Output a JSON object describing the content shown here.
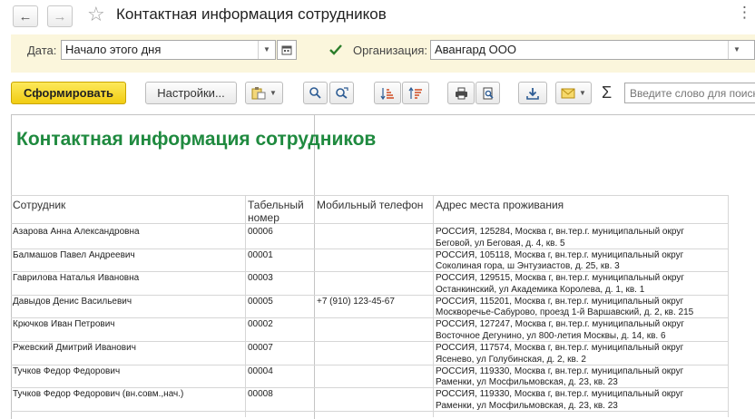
{
  "window": {
    "title": "Контактная информация сотрудников",
    "back_glyph": "←",
    "forward_glyph": "→",
    "favorite_glyph": "☆",
    "menu_glyph": "⋮"
  },
  "filters": {
    "date_label": "Дата:",
    "date_value": "Начало этого дня",
    "org_checked": true,
    "org_label": "Организация:",
    "org_value": "Авангард ООО"
  },
  "toolbar": {
    "generate_label": "Сформировать",
    "settings_label": "Настройки...",
    "sigma_glyph": "Σ",
    "search_placeholder": "Введите слово для поиска"
  },
  "report": {
    "title": "Контактная информация сотрудников",
    "columns": {
      "employee": "Сотрудник",
      "tab_no_1": "Табельный",
      "tab_no_2": "номер",
      "phone": "Мобильный телефон",
      "address": "Адрес места проживания"
    },
    "rows": [
      {
        "name": "Азарова Анна Александровна",
        "tab": "00006",
        "phone": "",
        "addr1": "РОССИЯ, 125284, Москва г, вн.тер.г. муниципальный округ",
        "addr2": "Беговой, ул Беговая, д. 4, кв. 5"
      },
      {
        "name": "Балмашов Павел Андреевич",
        "tab": "00001",
        "phone": "",
        "addr1": "РОССИЯ, 105118, Москва г, вн.тер.г. муниципальный округ",
        "addr2": "Соколиная гора, ш Энтузиастов, д. 25, кв. 3"
      },
      {
        "name": "Гаврилова Наталья Ивановна",
        "tab": "00003",
        "phone": "",
        "addr1": "РОССИЯ, 129515, Москва г, вн.тер.г. муниципальный округ",
        "addr2": "Останкинский, ул Академика Королева, д. 1, кв. 1"
      },
      {
        "name": "Давыдов Денис Васильевич",
        "tab": "00005",
        "phone": "+7 (910) 123-45-67",
        "addr1": "РОССИЯ, 115201, Москва г, вн.тер.г. муниципальный округ",
        "addr2": "Москворечье-Сабурово, проезд 1-й Варшавский, д. 2, кв. 215"
      },
      {
        "name": "Крючков Иван Петрович",
        "tab": "00002",
        "phone": "",
        "addr1": "РОССИЯ, 127247, Москва г, вн.тер.г. муниципальный округ",
        "addr2": "Восточное Дегунино, ул 800-летия Москвы, д. 14, кв. 6"
      },
      {
        "name": "Ржевский Дмитрий Иванович",
        "tab": "00007",
        "phone": "",
        "addr1": "РОССИЯ, 117574, Москва г, вн.тер.г. муниципальный округ",
        "addr2": "Ясенево, ул Голубинская, д. 2, кв. 2"
      },
      {
        "name": "Тучков Федор Федорович",
        "tab": "00004",
        "phone": "",
        "addr1": "РОССИЯ, 119330, Москва г, вн.тер.г. муниципальный округ",
        "addr2": "Раменки, ул Мосфильмовская, д. 23, кв. 23"
      },
      {
        "name": "Тучков Федор Федорович (вн.совм.,нач.)",
        "tab": "00008",
        "phone": "",
        "addr1": "РОССИЯ, 119330, Москва г, вн.тер.г. муниципальный округ",
        "addr2": "Раменки, ул Мосфильмовская, д. 23, кв. 23"
      }
    ]
  }
}
